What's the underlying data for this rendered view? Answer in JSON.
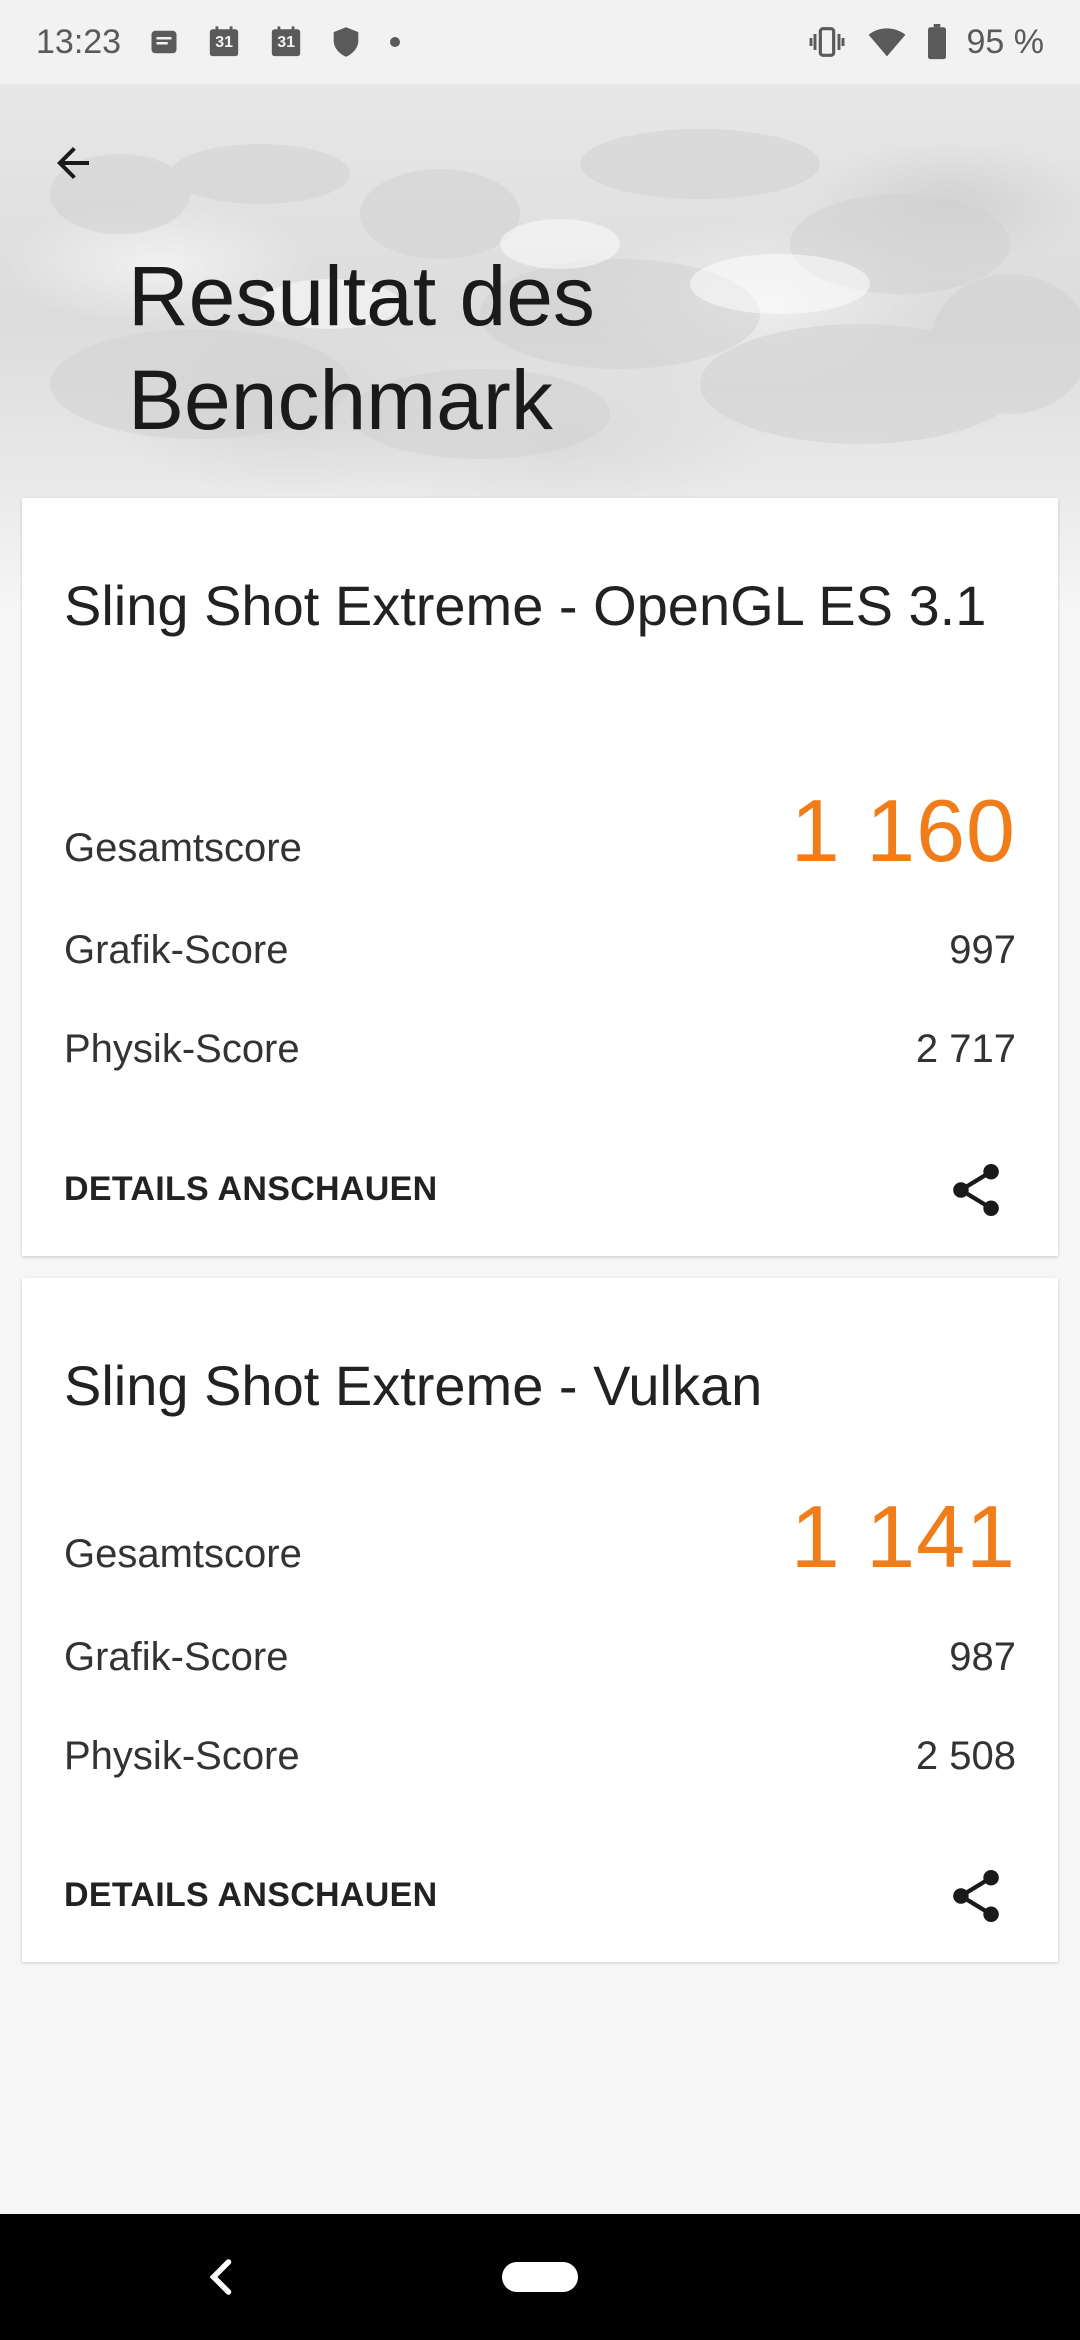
{
  "status_bar": {
    "time": "13:23",
    "notification_icons": [
      "message-icon",
      "calendar-31-icon",
      "calendar-31-icon",
      "shield-icon",
      "dot-icon"
    ],
    "calendar_day": "31",
    "battery_percent": "95 %",
    "right_icons": [
      "vibrate-icon",
      "wifi-icon",
      "battery-icon"
    ]
  },
  "header": {
    "title": "Resultat des Benchmark"
  },
  "results": [
    {
      "test_name": "Sling Shot Extreme - OpenGL ES 3.1",
      "total_label": "Gesamtscore",
      "total_score": "1 160",
      "graphics_label": "Grafik-Score",
      "graphics_score": "997",
      "physics_label": "Physik-Score",
      "physics_score": "2 717",
      "details_label": "DETAILS ANSCHAUEN"
    },
    {
      "test_name": "Sling Shot Extreme - Vulkan",
      "total_label": "Gesamtscore",
      "total_score": "1 141",
      "graphics_label": "Grafik-Score",
      "graphics_score": "987",
      "physics_label": "Physik-Score",
      "physics_score": "2 508",
      "details_label": "DETAILS ANSCHAUEN"
    }
  ],
  "colors": {
    "accent": "#f07c1a",
    "text": "#222222",
    "background": "#f6f6f6"
  }
}
